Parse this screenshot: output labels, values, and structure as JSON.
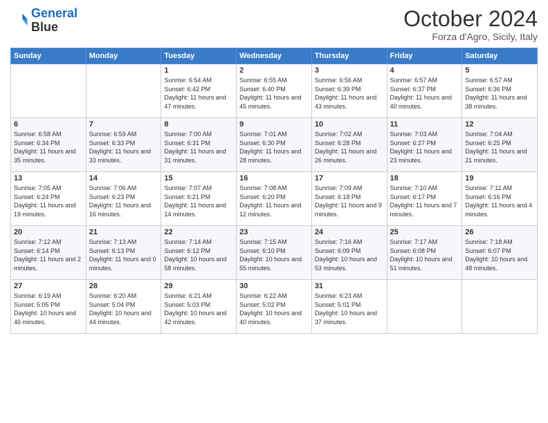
{
  "header": {
    "logo_line1": "General",
    "logo_line2": "Blue",
    "month": "October 2024",
    "location": "Forza d'Agro, Sicily, Italy"
  },
  "days_of_week": [
    "Sunday",
    "Monday",
    "Tuesday",
    "Wednesday",
    "Thursday",
    "Friday",
    "Saturday"
  ],
  "weeks": [
    [
      {
        "day": "",
        "sunrise": "",
        "sunset": "",
        "daylight": ""
      },
      {
        "day": "",
        "sunrise": "",
        "sunset": "",
        "daylight": ""
      },
      {
        "day": "1",
        "sunrise": "Sunrise: 6:54 AM",
        "sunset": "Sunset: 6:42 PM",
        "daylight": "Daylight: 11 hours and 47 minutes."
      },
      {
        "day": "2",
        "sunrise": "Sunrise: 6:55 AM",
        "sunset": "Sunset: 6:40 PM",
        "daylight": "Daylight: 11 hours and 45 minutes."
      },
      {
        "day": "3",
        "sunrise": "Sunrise: 6:56 AM",
        "sunset": "Sunset: 6:39 PM",
        "daylight": "Daylight: 11 hours and 43 minutes."
      },
      {
        "day": "4",
        "sunrise": "Sunrise: 6:57 AM",
        "sunset": "Sunset: 6:37 PM",
        "daylight": "Daylight: 11 hours and 40 minutes."
      },
      {
        "day": "5",
        "sunrise": "Sunrise: 6:57 AM",
        "sunset": "Sunset: 6:36 PM",
        "daylight": "Daylight: 11 hours and 38 minutes."
      }
    ],
    [
      {
        "day": "6",
        "sunrise": "Sunrise: 6:58 AM",
        "sunset": "Sunset: 6:34 PM",
        "daylight": "Daylight: 11 hours and 35 minutes."
      },
      {
        "day": "7",
        "sunrise": "Sunrise: 6:59 AM",
        "sunset": "Sunset: 6:33 PM",
        "daylight": "Daylight: 11 hours and 33 minutes."
      },
      {
        "day": "8",
        "sunrise": "Sunrise: 7:00 AM",
        "sunset": "Sunset: 6:31 PM",
        "daylight": "Daylight: 11 hours and 31 minutes."
      },
      {
        "day": "9",
        "sunrise": "Sunrise: 7:01 AM",
        "sunset": "Sunset: 6:30 PM",
        "daylight": "Daylight: 11 hours and 28 minutes."
      },
      {
        "day": "10",
        "sunrise": "Sunrise: 7:02 AM",
        "sunset": "Sunset: 6:28 PM",
        "daylight": "Daylight: 11 hours and 26 minutes."
      },
      {
        "day": "11",
        "sunrise": "Sunrise: 7:03 AM",
        "sunset": "Sunset: 6:27 PM",
        "daylight": "Daylight: 11 hours and 23 minutes."
      },
      {
        "day": "12",
        "sunrise": "Sunrise: 7:04 AM",
        "sunset": "Sunset: 6:25 PM",
        "daylight": "Daylight: 11 hours and 21 minutes."
      }
    ],
    [
      {
        "day": "13",
        "sunrise": "Sunrise: 7:05 AM",
        "sunset": "Sunset: 6:24 PM",
        "daylight": "Daylight: 11 hours and 19 minutes."
      },
      {
        "day": "14",
        "sunrise": "Sunrise: 7:06 AM",
        "sunset": "Sunset: 6:23 PM",
        "daylight": "Daylight: 11 hours and 16 minutes."
      },
      {
        "day": "15",
        "sunrise": "Sunrise: 7:07 AM",
        "sunset": "Sunset: 6:21 PM",
        "daylight": "Daylight: 11 hours and 14 minutes."
      },
      {
        "day": "16",
        "sunrise": "Sunrise: 7:08 AM",
        "sunset": "Sunset: 6:20 PM",
        "daylight": "Daylight: 11 hours and 12 minutes."
      },
      {
        "day": "17",
        "sunrise": "Sunrise: 7:09 AM",
        "sunset": "Sunset: 6:18 PM",
        "daylight": "Daylight: 11 hours and 9 minutes."
      },
      {
        "day": "18",
        "sunrise": "Sunrise: 7:10 AM",
        "sunset": "Sunset: 6:17 PM",
        "daylight": "Daylight: 11 hours and 7 minutes."
      },
      {
        "day": "19",
        "sunrise": "Sunrise: 7:11 AM",
        "sunset": "Sunset: 6:16 PM",
        "daylight": "Daylight: 11 hours and 4 minutes."
      }
    ],
    [
      {
        "day": "20",
        "sunrise": "Sunrise: 7:12 AM",
        "sunset": "Sunset: 6:14 PM",
        "daylight": "Daylight: 11 hours and 2 minutes."
      },
      {
        "day": "21",
        "sunrise": "Sunrise: 7:13 AM",
        "sunset": "Sunset: 6:13 PM",
        "daylight": "Daylight: 11 hours and 0 minutes."
      },
      {
        "day": "22",
        "sunrise": "Sunrise: 7:14 AM",
        "sunset": "Sunset: 6:12 PM",
        "daylight": "Daylight: 10 hours and 58 minutes."
      },
      {
        "day": "23",
        "sunrise": "Sunrise: 7:15 AM",
        "sunset": "Sunset: 6:10 PM",
        "daylight": "Daylight: 10 hours and 55 minutes."
      },
      {
        "day": "24",
        "sunrise": "Sunrise: 7:16 AM",
        "sunset": "Sunset: 6:09 PM",
        "daylight": "Daylight: 10 hours and 53 minutes."
      },
      {
        "day": "25",
        "sunrise": "Sunrise: 7:17 AM",
        "sunset": "Sunset: 6:08 PM",
        "daylight": "Daylight: 10 hours and 51 minutes."
      },
      {
        "day": "26",
        "sunrise": "Sunrise: 7:18 AM",
        "sunset": "Sunset: 6:07 PM",
        "daylight": "Daylight: 10 hours and 48 minutes."
      }
    ],
    [
      {
        "day": "27",
        "sunrise": "Sunrise: 6:19 AM",
        "sunset": "Sunset: 5:05 PM",
        "daylight": "Daylight: 10 hours and 46 minutes."
      },
      {
        "day": "28",
        "sunrise": "Sunrise: 6:20 AM",
        "sunset": "Sunset: 5:04 PM",
        "daylight": "Daylight: 10 hours and 44 minutes."
      },
      {
        "day": "29",
        "sunrise": "Sunrise: 6:21 AM",
        "sunset": "Sunset: 5:03 PM",
        "daylight": "Daylight: 10 hours and 42 minutes."
      },
      {
        "day": "30",
        "sunrise": "Sunrise: 6:22 AM",
        "sunset": "Sunset: 5:02 PM",
        "daylight": "Daylight: 10 hours and 40 minutes."
      },
      {
        "day": "31",
        "sunrise": "Sunrise: 6:23 AM",
        "sunset": "Sunset: 5:01 PM",
        "daylight": "Daylight: 10 hours and 37 minutes."
      },
      {
        "day": "",
        "sunrise": "",
        "sunset": "",
        "daylight": ""
      },
      {
        "day": "",
        "sunrise": "",
        "sunset": "",
        "daylight": ""
      }
    ]
  ]
}
